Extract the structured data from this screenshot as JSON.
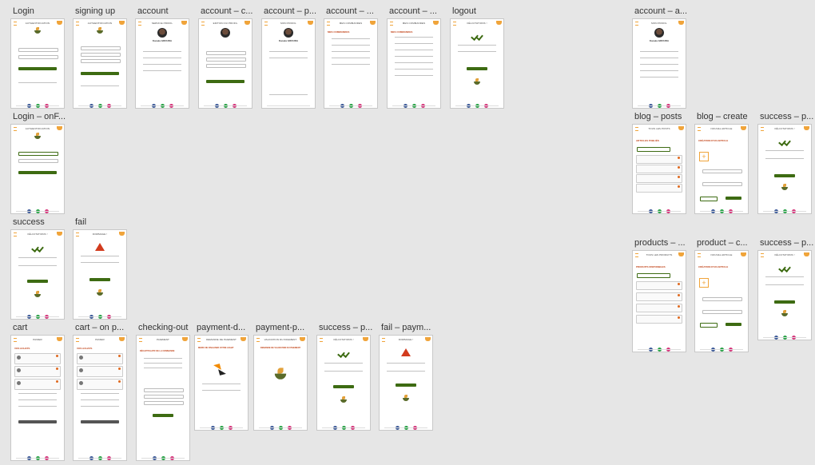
{
  "canvas": {
    "background": "#e6e6e6"
  },
  "colors": {
    "brand_green": "#3d6b12",
    "brand_orange": "#f0a43a",
    "alert_red": "#d23b1e"
  },
  "frames": [
    {
      "id": "login",
      "label": "Login"
    },
    {
      "id": "signing_up",
      "label": "signing up"
    },
    {
      "id": "account",
      "label": "account"
    },
    {
      "id": "account_c",
      "label": "account – c..."
    },
    {
      "id": "account_p",
      "label": "account – p..."
    },
    {
      "id": "account_orders_1",
      "label": "account – ..."
    },
    {
      "id": "account_orders_2",
      "label": "account – ..."
    },
    {
      "id": "logout",
      "label": "logout"
    },
    {
      "id": "account_a",
      "label": "account – a..."
    },
    {
      "id": "login_onf",
      "label": "Login – onF..."
    },
    {
      "id": "blog_posts",
      "label": "blog – posts"
    },
    {
      "id": "blog_create",
      "label": "blog – create"
    },
    {
      "id": "success_p1",
      "label": "success – p..."
    },
    {
      "id": "success",
      "label": "success"
    },
    {
      "id": "fail",
      "label": "fail"
    },
    {
      "id": "products",
      "label": "products – ..."
    },
    {
      "id": "product_c",
      "label": "product – c..."
    },
    {
      "id": "success_p2",
      "label": "success – p..."
    },
    {
      "id": "cart",
      "label": "cart"
    },
    {
      "id": "cart_on",
      "label": "cart – on p..."
    },
    {
      "id": "checking_out",
      "label": "checking-out"
    },
    {
      "id": "payment_d",
      "label": "payment-d..."
    },
    {
      "id": "payment_p",
      "label": "payment-p..."
    },
    {
      "id": "success_pay",
      "label": "success – p..."
    },
    {
      "id": "fail_pay",
      "label": "fail – paym..."
    }
  ],
  "screens": {
    "login": {
      "title": "Authentification"
    },
    "signing_up": {
      "title": "Authentification"
    },
    "account": {
      "title": "Service profil",
      "name": "Kaouia GROUDA"
    },
    "account_c": {
      "title": "Edition du profil"
    },
    "account_p": {
      "title": "Mon profil",
      "name": "Kaouia GROUDA"
    },
    "account_orders_1": {
      "title": "Mes commandes",
      "section": "MES COMMANDES"
    },
    "account_orders_2": {
      "title": "Mes commandes",
      "section": "MES COMMANDES"
    },
    "logout": {
      "title": "Félicitations !"
    },
    "account_a": {
      "title": "Mon profil",
      "name": "Kaouia GROUDA"
    },
    "login_onf": {
      "title": "Authentification"
    },
    "blog_posts": {
      "title": "Tous les posts",
      "section": "ARTICLES PUBLIÉS"
    },
    "blog_create": {
      "title": "Nouvel article",
      "section": "CRÉATION D'UN ARTICLE"
    },
    "success_p1": {
      "title": "Félicitations !"
    },
    "success": {
      "title": "Félicitations !"
    },
    "fail": {
      "title": "Dommage !"
    },
    "products": {
      "title": "Tous les produits",
      "section": "PRODUITS DISPONIBLES"
    },
    "product_c": {
      "title": "Nouvel article",
      "section": "CRÉATION D'UN ARTICLE"
    },
    "success_p2": {
      "title": "Félicitations !"
    },
    "cart": {
      "title": "Panier",
      "section": "VOS ACHATS"
    },
    "cart_on": {
      "title": "Panier",
      "section": "VOS ACHATS"
    },
    "checking_out": {
      "title": "Paiement",
      "section": "RÉCAPITULATIF DE LA COMMANDE"
    },
    "payment_d": {
      "title": "Demande de paiement",
      "section": "MERCI DE FINALISER VOTRE ACHAT"
    },
    "payment_p": {
      "title": "Validation du paiement",
      "section": "DEMANDE DE VALIDATION DU PAIEMENT"
    },
    "success_pay": {
      "title": "Félicitations !"
    },
    "fail_pay": {
      "title": "Dommage !"
    }
  }
}
